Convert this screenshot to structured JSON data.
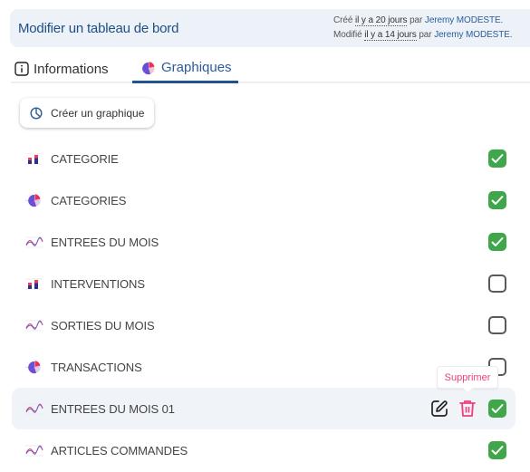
{
  "header": {
    "title": "Modifier un tableau de bord",
    "created": {
      "prefix": "Créé",
      "relative": "il y a 20 jours",
      "by": "par",
      "user": "Jeremy MODESTE."
    },
    "modified": {
      "prefix": "Modifié",
      "relative": "il y a 14 jours",
      "by": "par",
      "user": "Jeremy MODESTE."
    }
  },
  "tabs": [
    {
      "label": "Informations",
      "icon": "info-icon",
      "active": false
    },
    {
      "label": "Graphiques",
      "icon": "pie-chart-icon",
      "active": true
    }
  ],
  "create_button": {
    "label": "Créer un graphique",
    "icon": "chart-pie-outline-icon"
  },
  "charts": [
    {
      "label": "CATEGORIE",
      "type": "bar",
      "checked": true
    },
    {
      "label": "CATEGORIES",
      "type": "pie",
      "checked": true
    },
    {
      "label": "ENTREES DU MOIS",
      "type": "line",
      "checked": true
    },
    {
      "label": "INTERVENTIONS",
      "type": "bar",
      "checked": false
    },
    {
      "label": "SORTIES DU MOIS",
      "type": "line",
      "checked": false
    },
    {
      "label": "TRANSACTIONS",
      "type": "pie",
      "checked": false
    },
    {
      "label": "ENTREES DU MOIS 01",
      "type": "line",
      "checked": true,
      "hovered": true
    },
    {
      "label": "ARTICLES COMMANDES",
      "type": "line",
      "checked": true
    }
  ],
  "row_actions": {
    "edit_icon": "edit-icon",
    "delete_icon": "trash-icon"
  },
  "tooltip": {
    "label": "Supprimer"
  },
  "colors": {
    "primary": "#1f5490",
    "check_on": "#3fa64a",
    "delete": "#ee3f7a",
    "header_bg": "#edf2f8"
  }
}
